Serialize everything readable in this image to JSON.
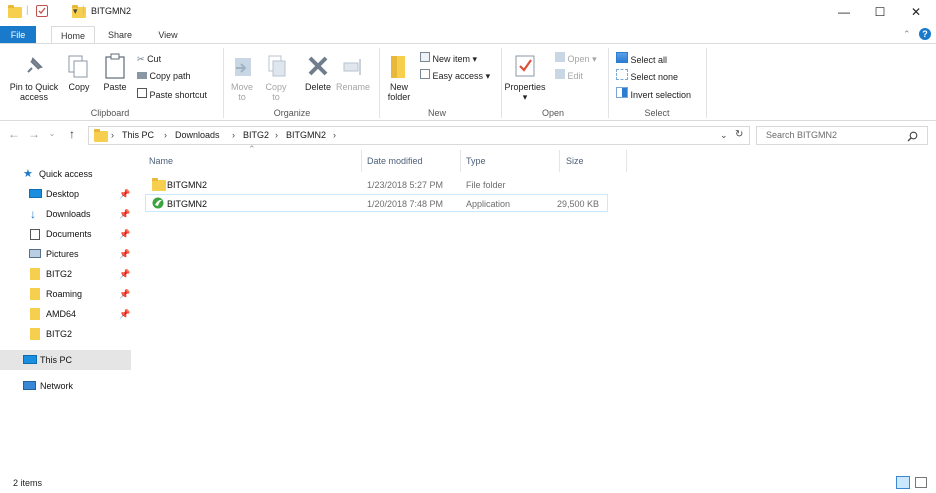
{
  "window": {
    "title": "BITGMN2",
    "minimize": "—",
    "maximize": "☐",
    "close": "✕"
  },
  "tabs": [
    "File",
    "Home",
    "Share",
    "View"
  ],
  "ribbon": {
    "clipboard": {
      "pin_to_quick_access": "Pin to Quick access",
      "copy": "Copy",
      "paste": "Paste",
      "cut": "Cut",
      "copy_path": "Copy path",
      "paste_shortcut": "Paste shortcut",
      "label": "Clipboard"
    },
    "organize": {
      "move_to": "Move to",
      "copy_to": "Copy to",
      "delete": "Delete",
      "rename": "Rename",
      "label": "Organize"
    },
    "new": {
      "new_folder": "New folder",
      "new_item": "New item",
      "easy_access": "Easy access",
      "label": "New"
    },
    "open": {
      "properties": "Properties",
      "open": "Open",
      "edit": "Edit",
      "label": "Open"
    },
    "select": {
      "select_all": "Select all",
      "select_none": "Select none",
      "invert_selection": "Invert selection",
      "label": "Select"
    }
  },
  "address": {
    "crumbs": [
      "This PC",
      "Downloads",
      "BITG2",
      "BITGMN2"
    ],
    "search_placeholder": "Search BITGMN2"
  },
  "nav": {
    "quick_access": "Quick access",
    "items": [
      {
        "label": "Desktop",
        "icon": "desktop-icon",
        "pinned": true
      },
      {
        "label": "Downloads",
        "icon": "downloads-icon",
        "pinned": true
      },
      {
        "label": "Documents",
        "icon": "documents-icon",
        "pinned": true
      },
      {
        "label": "Pictures",
        "icon": "pictures-icon",
        "pinned": true
      },
      {
        "label": "BITG2",
        "icon": "folder-icon",
        "pinned": true
      },
      {
        "label": "Roaming",
        "icon": "folder-icon",
        "pinned": true
      },
      {
        "label": "AMD64",
        "icon": "folder-icon",
        "pinned": true
      },
      {
        "label": "BITG2",
        "icon": "folder-icon",
        "pinned": false
      }
    ],
    "this_pc": "This PC",
    "network": "Network"
  },
  "columns": {
    "name": "Name",
    "date_modified": "Date modified",
    "type": "Type",
    "size": "Size"
  },
  "files": [
    {
      "name": "BITGMN2",
      "date": "1/23/2018 5:27 PM",
      "type": "File folder",
      "size": "",
      "icon": "folder-icon"
    },
    {
      "name": "BITGMN2",
      "date": "1/20/2018 7:48 PM",
      "type": "Application",
      "size": "29,500 KB",
      "icon": "application-icon"
    }
  ],
  "status": {
    "items": "2 items"
  },
  "colors": {
    "accent": "#1979ca",
    "folder": "#f7cf4e",
    "selection": "#cce8ff"
  }
}
